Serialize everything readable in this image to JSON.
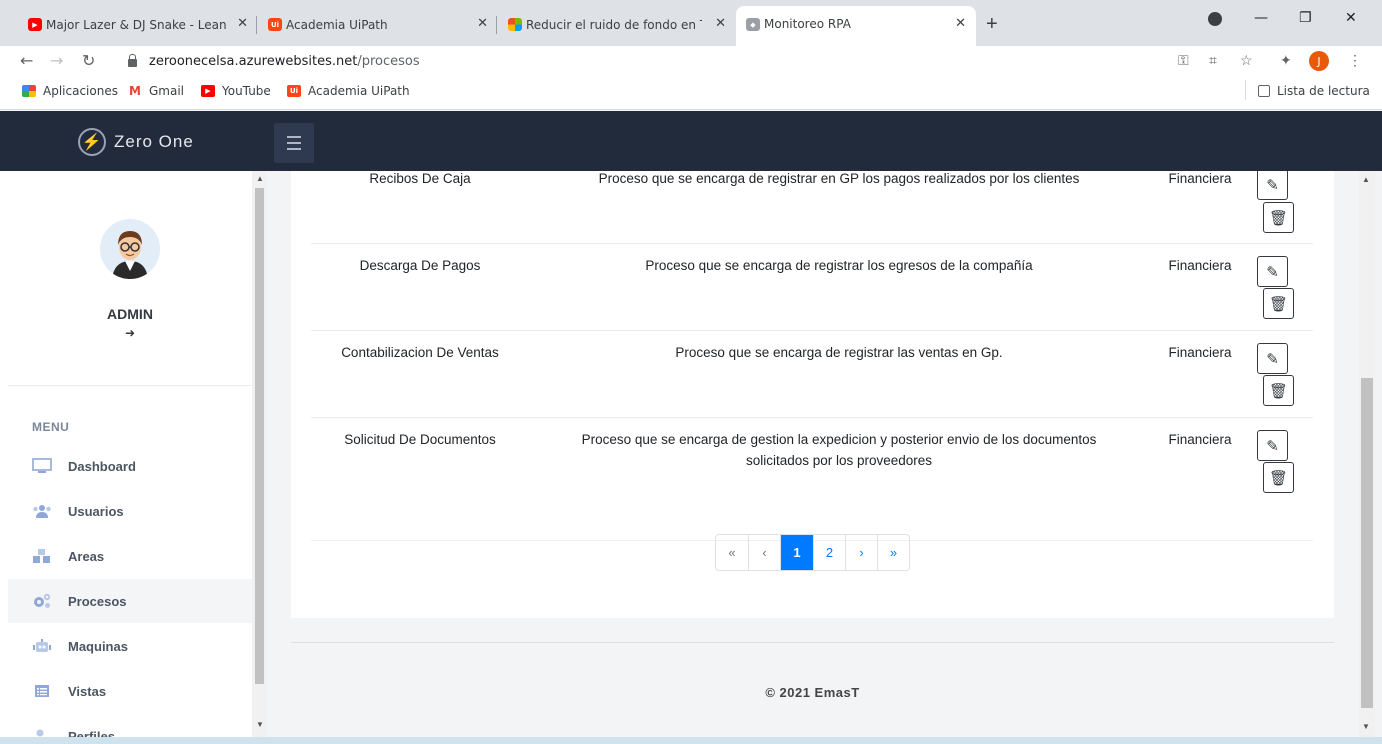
{
  "browser": {
    "tabs": [
      {
        "title": "Major Lazer & DJ Snake - Lean On",
        "favicon": "youtube-icon",
        "color": "#ff0000"
      },
      {
        "title": "Academia UiPath",
        "favicon": "uipath-icon",
        "color": "#fa4616"
      },
      {
        "title": "Reducir el ruido de fondo en Teams",
        "favicon": "microsoft-icon",
        "color": "#00a4ef"
      },
      {
        "title": "Monitoreo RPA",
        "favicon": "app-icon",
        "color": "#5f6368",
        "active": true
      }
    ],
    "new_tab": "+",
    "url_host": "zeroonecelsa.azurewebsites.net",
    "url_path": "/procesos",
    "profile_initial": "J",
    "bookmarks": [
      {
        "label": "Aplicaciones"
      },
      {
        "label": "Gmail"
      },
      {
        "label": "YouTube"
      },
      {
        "label": "Academia UiPath"
      }
    ],
    "reading_list": "Lista de lectura"
  },
  "app": {
    "brand": "Zero One",
    "user": {
      "name": "ADMIN"
    },
    "menu_title": "MENU",
    "menu": [
      {
        "label": "Dashboard",
        "icon": "monitor-icon"
      },
      {
        "label": "Usuarios",
        "icon": "users-icon"
      },
      {
        "label": "Areas",
        "icon": "boxes-icon"
      },
      {
        "label": "Procesos",
        "icon": "gears-icon",
        "active": true
      },
      {
        "label": "Maquinas",
        "icon": "robot-icon"
      },
      {
        "label": "Vistas",
        "icon": "list-icon"
      },
      {
        "label": "Perfiles",
        "icon": "profile-icon"
      }
    ]
  },
  "table": {
    "rows": [
      {
        "name": "Recibos De Caja",
        "description": "Proceso que se encarga de registrar en GP los pagos realizados por los clientes",
        "area": "Financiera"
      },
      {
        "name": "Descarga De Pagos",
        "description": "Proceso que se encarga de registrar los egresos de la compañía",
        "area": "Financiera"
      },
      {
        "name": "Contabilizacion De Ventas",
        "description": "Proceso que se encarga de registrar las ventas en Gp.",
        "area": "Financiera"
      },
      {
        "name": "Solicitud De Documentos",
        "description": "Proceso que se encarga de gestion la expedicion y posterior envio de los documentos solicitados por los proveedores",
        "area": "Financiera"
      }
    ]
  },
  "pagination": {
    "first": "«",
    "prev": "‹",
    "pages": [
      "1",
      "2"
    ],
    "current": "1",
    "next": "›",
    "last": "»"
  },
  "footer": "© 2021 EmasT"
}
